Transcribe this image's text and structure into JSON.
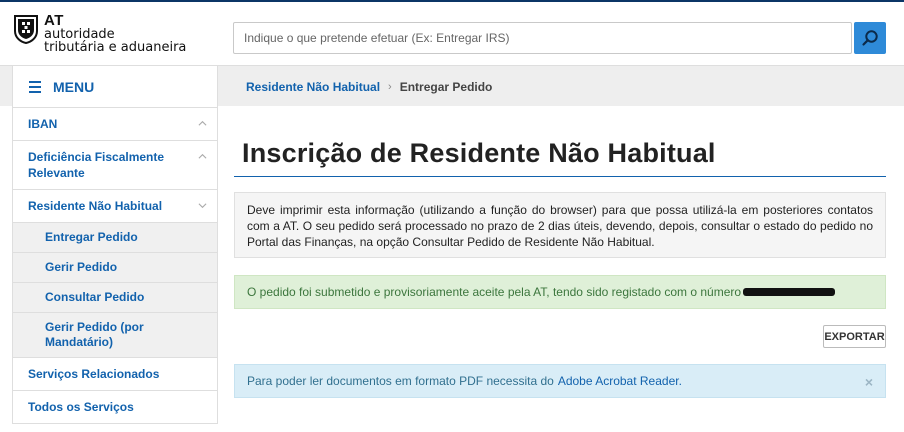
{
  "logo": {
    "line1": "AT",
    "line2": "autoridade",
    "line3": "tributária e aduaneira"
  },
  "search": {
    "placeholder": "Indique o que pretende efetuar (Ex: Entregar IRS)",
    "button_icon": "search-icon"
  },
  "menu": {
    "label": "MENU"
  },
  "breadcrumb": {
    "link": "Residente Não Habitual",
    "current": "Entregar Pedido"
  },
  "sidebar": {
    "items": [
      {
        "label": "IBAN",
        "chevron": "up"
      },
      {
        "label": "Deficiência Fiscalmente Relevante",
        "chevron": "up"
      },
      {
        "label": "Residente Não Habitual",
        "chevron": "down"
      }
    ],
    "subitems": [
      {
        "label": "Entregar Pedido"
      },
      {
        "label": "Gerir Pedido"
      },
      {
        "label": "Consultar Pedido"
      },
      {
        "label": "Gerir Pedido (por Mandatário)"
      }
    ],
    "bottom_items": [
      {
        "label": "Serviços Relacionados"
      },
      {
        "label": "Todos os Serviços"
      }
    ]
  },
  "main": {
    "title": "Inscrição de Residente Não Habitual",
    "info_text": "Deve imprimir esta informação (utilizando a função do browser) para que possa utilizá-la em posteriores contatos com a AT. O seu pedido será processado no prazo de 2 dias úteis, devendo, depois, consultar o estado do pedido no Portal das Finanças, na opção Consultar Pedido de Residente Não Habitual.",
    "success_text": "O pedido foi submetido e provisoriamente aceite pela AT, tendo sido registado com o número",
    "export_label": "EXPORTAR",
    "note_text": "Para poder ler documentos em formato PDF necessita do",
    "note_link": "Adobe Acrobat Reader.",
    "note_close": "×"
  },
  "colors": {
    "brand_blue": "#1262ad",
    "search_button": "#2e8ad8",
    "success_bg": "#dff0d8",
    "info_bg": "#d9edf7"
  }
}
